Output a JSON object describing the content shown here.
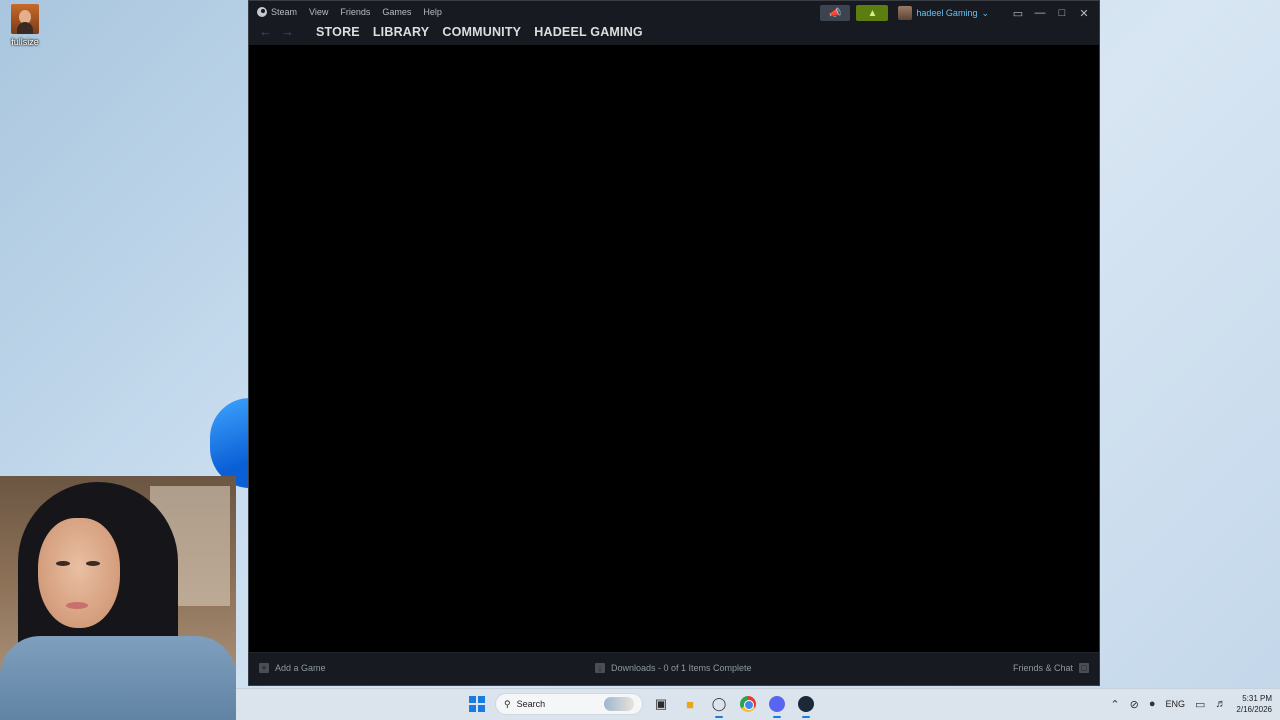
{
  "desktop": {
    "icon_label": "fullsize"
  },
  "steam": {
    "menu": [
      "Steam",
      "View",
      "Friends",
      "Games",
      "Help"
    ],
    "nav_tabs": [
      "STORE",
      "LIBRARY",
      "COMMUNITY",
      "HADEEL GAMING"
    ],
    "account_name": "hadeel Gaming",
    "account_caret": "⌄",
    "add_game": "Add a Game",
    "downloads": "Downloads - 0 of 1 Items Complete",
    "friends_chat": "Friends & Chat",
    "colors": {
      "titlebar": "#171a21",
      "notify_green": "#5c7e10",
      "account_blue": "#67c1f5"
    }
  },
  "taskbar": {
    "search_label": "Search",
    "language": "ENG",
    "time": "5:31 PM",
    "date": "2/16/2026"
  }
}
